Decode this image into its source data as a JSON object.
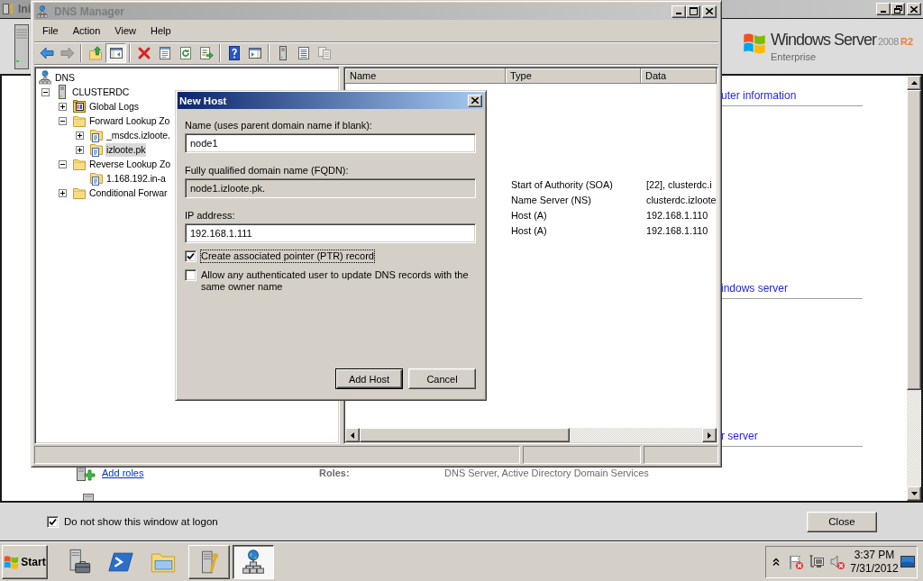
{
  "background_window": {
    "title": "Ini",
    "logo": {
      "name": "Windows Server",
      "version": "2008",
      "release": "R2",
      "edition": "Enterprise"
    },
    "sections": [
      {
        "heading": "uter information"
      },
      {
        "heading": "indows server"
      },
      {
        "heading": "r server"
      }
    ],
    "roles_row": {
      "link": "Add roles",
      "label": "Roles:",
      "value": "DNS Server, Active Directory Domain Services"
    },
    "dont_show_checkbox": {
      "label": "Do not show this window at logon",
      "checked": true
    },
    "close_button": "Close"
  },
  "dns_manager": {
    "title": "DNS Manager",
    "menu": [
      "File",
      "Action",
      "View",
      "Help"
    ],
    "toolbar": [
      {
        "buttons": [
          {
            "kind": "back",
            "pressed": false,
            "disabled": false
          },
          {
            "kind": "forward",
            "pressed": false,
            "disabled": true
          }
        ]
      },
      {
        "buttons": [
          {
            "kind": "up",
            "pressed": false,
            "disabled": false
          },
          {
            "kind": "tree",
            "pressed": true,
            "disabled": false
          }
        ]
      },
      {
        "buttons": [
          {
            "kind": "delete",
            "pressed": false,
            "disabled": false
          },
          {
            "kind": "properties",
            "pressed": false,
            "disabled": false
          },
          {
            "kind": "refresh",
            "pressed": false,
            "disabled": false
          },
          {
            "kind": "export",
            "pressed": false,
            "disabled": false
          }
        ]
      },
      {
        "buttons": [
          {
            "kind": "help",
            "pressed": false,
            "disabled": false
          },
          {
            "kind": "pane",
            "pressed": false,
            "disabled": false
          }
        ]
      },
      {
        "buttons": [
          {
            "kind": "server",
            "pressed": false,
            "disabled": false
          },
          {
            "kind": "list",
            "pressed": false,
            "disabled": false
          },
          {
            "kind": "copy",
            "pressed": false,
            "disabled": true
          }
        ]
      }
    ],
    "tree": [
      {
        "label": "DNS",
        "kind": "dns",
        "selected": false,
        "children": [
          {
            "label": "CLUSTERDC",
            "kind": "server",
            "expanded": true,
            "selected": false,
            "children": [
              {
                "label": "Global Logs",
                "kind": "logs",
                "expanded": false,
                "selected": false
              },
              {
                "label": "Forward Lookup Zo",
                "kind": "folder",
                "expanded": true,
                "selected": false,
                "children": [
                  {
                    "label": "_msdcs.izloote.",
                    "kind": "zone",
                    "expanded": false,
                    "selected": false
                  },
                  {
                    "label": "izloote.pk",
                    "kind": "zone",
                    "expanded": false,
                    "selected": true
                  }
                ]
              },
              {
                "label": "Reverse Lookup Zo",
                "kind": "folder",
                "expanded": true,
                "selected": false,
                "children": [
                  {
                    "label": "1.168.192.in-a",
                    "kind": "zone",
                    "selected": false
                  }
                ]
              },
              {
                "label": "Conditional Forwar",
                "kind": "folder",
                "expanded": false,
                "selected": false
              }
            ]
          }
        ]
      }
    ],
    "list": {
      "columns": [
        "Name",
        "Type",
        "Data"
      ],
      "rows": [
        {
          "type": "Start of Authority (SOA)",
          "data": "[22], clusterdc.i"
        },
        {
          "type": "Name Server (NS)",
          "data": "clusterdc.izloote"
        },
        {
          "type": "Host (A)",
          "data": "192.168.1.110"
        },
        {
          "type": "Host (A)",
          "data": "192.168.1.110"
        }
      ]
    }
  },
  "dialog": {
    "title": "New Host",
    "fields": [
      {
        "label": "Name (uses parent domain name if blank):",
        "value": "node1",
        "read_only": false
      },
      {
        "label": "Fully qualified domain name (FQDN):",
        "value": "node1.izloote.pk.",
        "read_only": true
      },
      {
        "label": "IP address:",
        "value": "192.168.1.111",
        "read_only": false
      }
    ],
    "checkboxes": [
      {
        "label": "Create associated pointer (PTR) record",
        "checked": true,
        "focused": true
      },
      {
        "label": "Allow any authenticated user to update DNS records with the same owner name",
        "checked": false,
        "focused": false
      }
    ],
    "buttons": [
      {
        "label": "Add Host",
        "default": true
      },
      {
        "label": "Cancel",
        "default": false
      }
    ]
  },
  "taskbar": {
    "start": "Start",
    "task_buttons": [
      {
        "kind": "tools",
        "selected": false
      },
      {
        "kind": "dns",
        "selected": true
      }
    ],
    "clock": {
      "time": "3:37 PM",
      "date": "7/31/2012"
    }
  }
}
